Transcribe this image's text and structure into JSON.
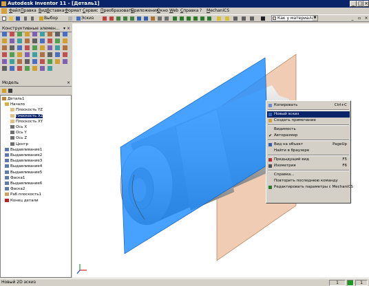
{
  "window": {
    "title": "Autodesk Inventor 11 - [Деталь1]"
  },
  "menu": [
    "Файл",
    "Правка",
    "Вид",
    "Вставка",
    "Формат",
    "Сервис",
    "Преобразовать",
    "Приложения",
    "Окно",
    "Web",
    "Справка",
    "?",
    "MechaniCS"
  ],
  "toolbar": {
    "select_label": "Выбор",
    "sketch_label": "Эскиз",
    "material_combo": "Как у материала"
  },
  "panel": {
    "title": "Конструктивные элемен...",
    "browser_title": "Модель"
  },
  "tree": [
    {
      "label": "Деталь1",
      "icon": "part-icon"
    },
    {
      "label": "Начало",
      "icon": "folder-icon"
    },
    {
      "label": "Плоскость YZ",
      "icon": "plane-icon"
    },
    {
      "label": "Плоскость XZ",
      "icon": "plane-icon",
      "selected": true
    },
    {
      "label": "Плоскость XY",
      "icon": "plane-icon"
    },
    {
      "label": "Ось X",
      "icon": "axis-icon"
    },
    {
      "label": "Ось Y",
      "icon": "axis-icon"
    },
    {
      "label": "Ось Z",
      "icon": "axis-icon"
    },
    {
      "label": "Центр",
      "icon": "point-icon"
    },
    {
      "label": "Выдавливание1",
      "icon": "extrude-icon"
    },
    {
      "label": "Выдавливание2",
      "icon": "extrude-icon"
    },
    {
      "label": "Выдавливание3",
      "icon": "extrude-icon"
    },
    {
      "label": "Выдавливание4",
      "icon": "extrude-icon"
    },
    {
      "label": "Выдавливание5",
      "icon": "extrude-icon"
    },
    {
      "label": "Фаска1",
      "icon": "chamfer-icon"
    },
    {
      "label": "Выдавливание6",
      "icon": "extrude-icon"
    },
    {
      "label": "Фаска2",
      "icon": "chamfer-icon"
    },
    {
      "label": "Раб.плоскость1",
      "icon": "workplane-icon"
    },
    {
      "label": "Конец детали",
      "icon": "end-of-part-icon"
    }
  ],
  "context_menu": [
    {
      "label": "Копировать",
      "shortcut": "Ctrl+C",
      "icon": "copy-icon"
    },
    {
      "separator": true
    },
    {
      "label": "Новый эскиз",
      "shortcut": "",
      "icon": "sketch-icon",
      "highlighted": true
    },
    {
      "label": "Создать примечание",
      "shortcut": "",
      "icon": "note-icon"
    },
    {
      "separator": true
    },
    {
      "label": "Видимость",
      "shortcut": ""
    },
    {
      "label": "Авторазмер",
      "shortcut": "",
      "checked": true
    },
    {
      "separator": true
    },
    {
      "label": "Вид на объект",
      "shortcut": "PageUp",
      "icon": "look-at-icon"
    },
    {
      "label": "Найти в браузере",
      "shortcut": ""
    },
    {
      "separator": true
    },
    {
      "label": "Предыдущий вид",
      "shortcut": "F5",
      "icon": "previous-view-icon"
    },
    {
      "label": "Изометрия",
      "shortcut": "F6",
      "icon": "isometric-icon"
    },
    {
      "separator": true
    },
    {
      "label": "Справка...",
      "shortcut": ""
    },
    {
      "label": "Повторить последнюю команду",
      "shortcut": ""
    },
    {
      "label": "Редактировать параметры с MechaniCS",
      "shortcut": "",
      "icon": "mechanics-icon"
    }
  ],
  "status": {
    "text": "Новый 2D эскиз",
    "page": "1",
    "count": "1"
  },
  "colors": {
    "title_bar": "#0a246a",
    "highlight": "#0a246a",
    "workplane_blue": "#1e8cff",
    "workplane_tan": "#e6b08a"
  }
}
